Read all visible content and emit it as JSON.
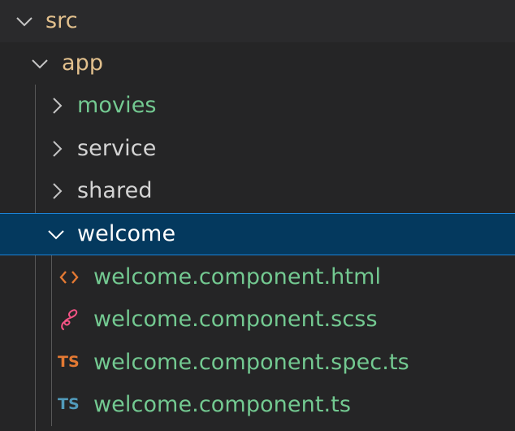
{
  "explorer": {
    "items": [
      {
        "label": "src",
        "kind": "folder",
        "expanded": true,
        "color": "#e2c08d"
      },
      {
        "label": "app",
        "kind": "folder",
        "expanded": true,
        "color": "#e2c08d"
      },
      {
        "label": "movies",
        "kind": "folder",
        "expanded": false,
        "color": "#73c991"
      },
      {
        "label": "service",
        "kind": "folder",
        "expanded": false,
        "color": "#d4d4d4"
      },
      {
        "label": "shared",
        "kind": "folder",
        "expanded": false,
        "color": "#d4d4d4"
      },
      {
        "label": "welcome",
        "kind": "folder",
        "expanded": true,
        "selected": true,
        "color": "#ffffff"
      },
      {
        "label": "welcome.component.html",
        "kind": "file",
        "icon": "html-file-icon",
        "icon_color": "#e37933",
        "color": "#73c991"
      },
      {
        "label": "welcome.component.scss",
        "kind": "file",
        "icon": "sass-file-icon",
        "icon_color": "#f55385",
        "color": "#73c991"
      },
      {
        "label": "welcome.component.spec.ts",
        "kind": "file",
        "icon": "typescript-spec-file-icon",
        "icon_text": "TS",
        "icon_color": "#e37933",
        "color": "#73c991"
      },
      {
        "label": "welcome.component.ts",
        "kind": "file",
        "icon": "typescript-file-icon",
        "icon_text": "TS",
        "icon_color": "#519aba",
        "color": "#73c991"
      }
    ]
  },
  "colors": {
    "background": "#252526",
    "selection_bg": "#04395e",
    "selection_border": "#1c83d6",
    "chevron": "#c5c5c5",
    "indent_guide": "#585858"
  }
}
